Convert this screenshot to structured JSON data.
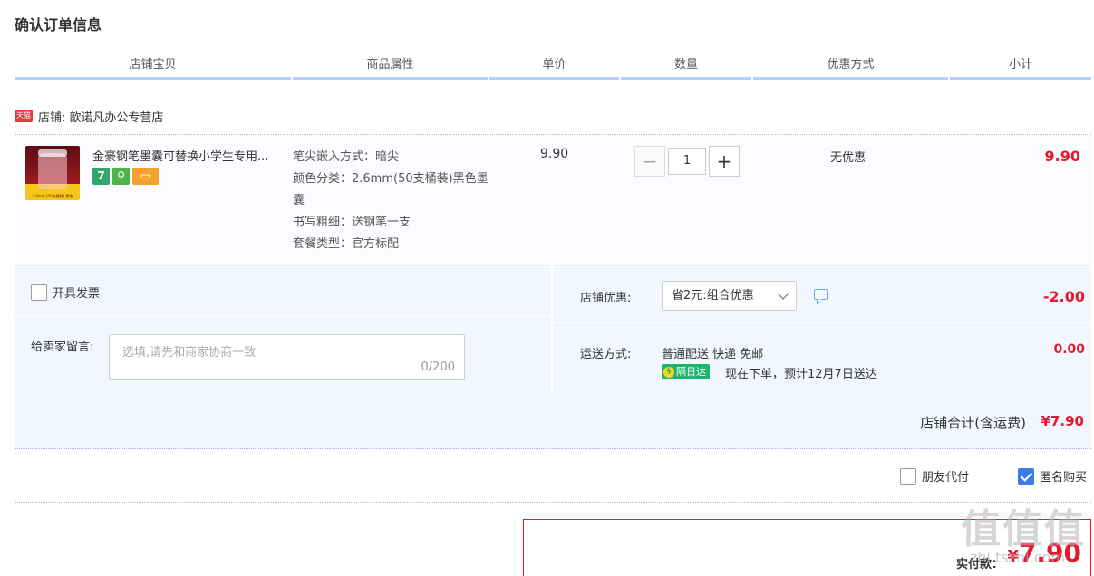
{
  "page": {
    "title": "确认订单信息"
  },
  "columns": [
    "店铺宝贝",
    "商品属性",
    "单价",
    "数量",
    "优惠方式",
    "小计"
  ],
  "shop": {
    "icon_label": "天猫",
    "label": "店铺:",
    "name": "歆诺凡办公专营店"
  },
  "item": {
    "name": "金豪钢笔墨囊可替换小学生专用...",
    "thumb_caption": "2.6mm (50支桶装) 黑色",
    "badges": [
      "7",
      "⚲",
      "▭"
    ],
    "props": [
      "笔尖嵌入方式：暗尖",
      "颜色分类：2.6mm(50支桶装)黑色墨囊",
      "书写粗细：送钢笔一支",
      "套餐类型：官方标配"
    ],
    "unit_price": "9.90",
    "quantity": "1",
    "minus": "−",
    "plus": "+",
    "discount": "无优惠",
    "subtotal": "9.90"
  },
  "options": {
    "invoice_label": "开具发票",
    "message_label": "给卖家留言:",
    "message_placeholder": "选填,请先和商家协商一致",
    "message_count": "0/200",
    "shop_discount_label": "店铺优惠:",
    "shop_discount_value": "省2元:组合优惠",
    "shop_discount_amount": "-2.00",
    "shipping_label": "运送方式:",
    "shipping_text": "普通配送 快递 免邮",
    "shipping_badge": "隔日达",
    "shipping_eta": "现在下单，预计12月7日送达",
    "shipping_amount": "0.00"
  },
  "total": {
    "label": "店铺合计(含运费)",
    "amount": "¥7.90"
  },
  "extras": {
    "friend_pay": "朋友代付",
    "anonymous": "匿名购买"
  },
  "pay": {
    "label": "实付款：",
    "currency": "¥",
    "amount": "7.90"
  },
  "watermark": {
    "main": "值值值",
    "sub": "zhi.tszhi.com"
  },
  "colors": {
    "accent_red": "#e4192e",
    "header_line": "#b2d1ff",
    "panel_bg": "#f2f7ff",
    "checkbox_blue": "#3d7be6",
    "ship_green": "#1cb56e"
  }
}
